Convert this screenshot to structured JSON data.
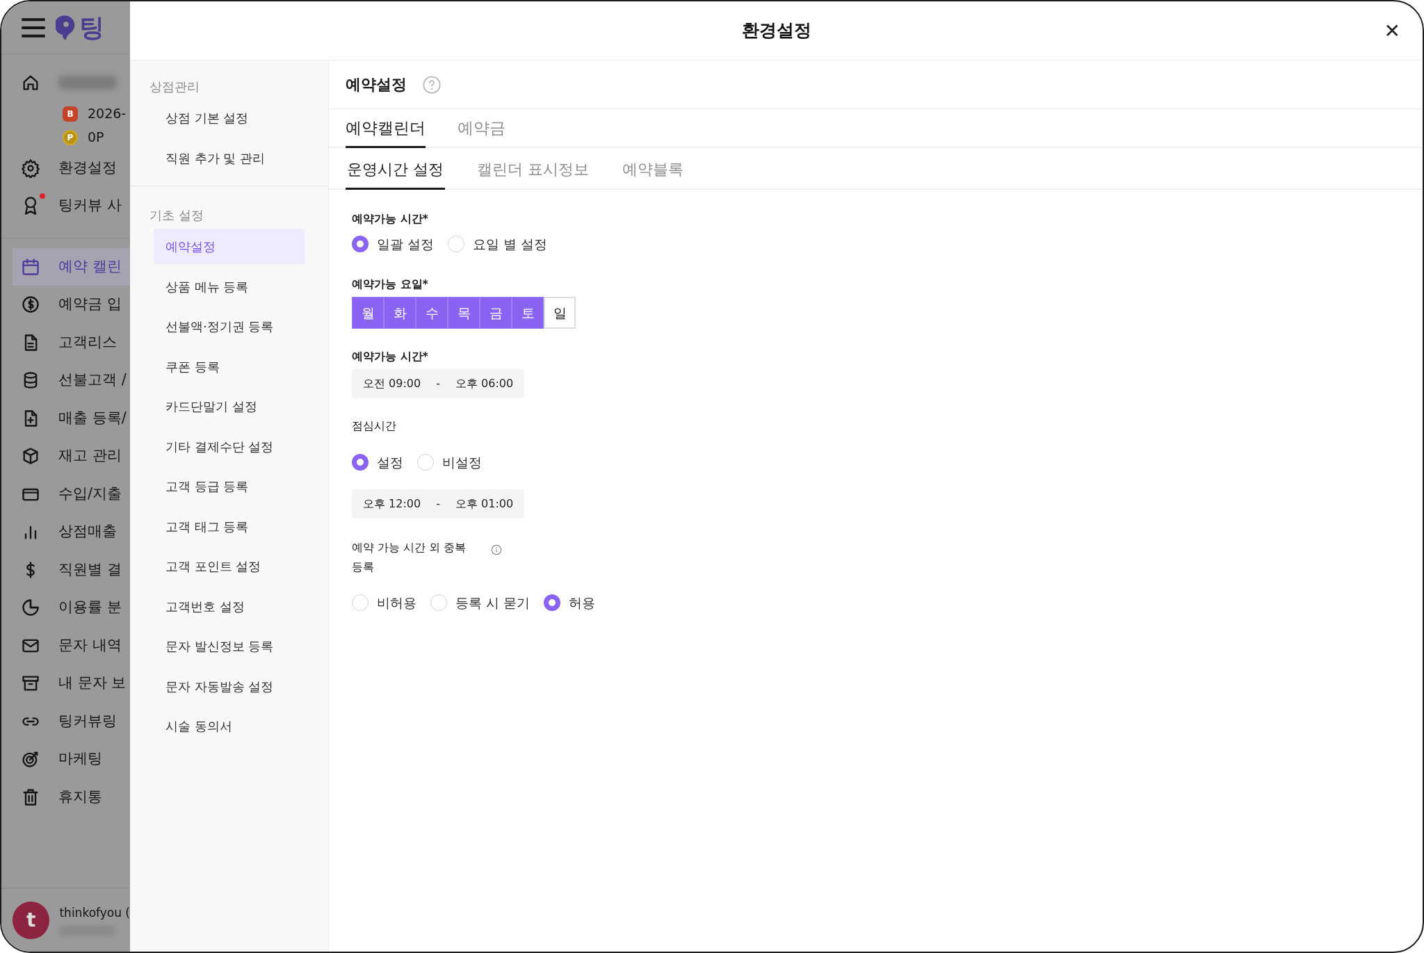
{
  "app_sidebar": {
    "logo_text": "팅",
    "profile": {
      "badge": "B",
      "expiry": "2026-",
      "points_badge": "P",
      "points": "0P"
    },
    "groups": [
      [
        {
          "label": "환경설정",
          "selected": false,
          "alert": false
        },
        {
          "label": "팅커뷰 사",
          "selected": false,
          "alert": true
        }
      ],
      [
        {
          "label": "예약 캘린",
          "selected": true,
          "alert": false
        },
        {
          "label": "예약금 입",
          "selected": false,
          "alert": false
        },
        {
          "label": "고객리스",
          "selected": false,
          "alert": false
        },
        {
          "label": "선불고객 /",
          "selected": false,
          "alert": false
        },
        {
          "label": "매출 등록/",
          "selected": false,
          "alert": false
        },
        {
          "label": "재고 관리",
          "selected": false,
          "alert": false
        },
        {
          "label": "수입/지출",
          "selected": false,
          "alert": false
        },
        {
          "label": "상점매출",
          "selected": false,
          "alert": false
        },
        {
          "label": "직원별 결",
          "selected": false,
          "alert": false
        },
        {
          "label": "이용률 분",
          "selected": false,
          "alert": false
        },
        {
          "label": "문자 내역",
          "selected": false,
          "alert": false
        },
        {
          "label": "내 문자 보",
          "selected": false,
          "alert": false
        },
        {
          "label": "팅커뷰링",
          "selected": false,
          "alert": false
        },
        {
          "label": "마케팅",
          "selected": false,
          "alert": false
        },
        {
          "label": "휴지통",
          "selected": false,
          "alert": false
        }
      ]
    ],
    "user": {
      "initial": "t",
      "name": "thinkofyou ("
    }
  },
  "modal": {
    "title": "환경설정",
    "close": "✕"
  },
  "settings_nav": [
    {
      "heading": "상점관리",
      "items": [
        {
          "label": "상점 기본 설정",
          "selected": false
        },
        {
          "label": "직원 추가 및 관리",
          "selected": false
        }
      ]
    },
    {
      "heading": "기초 설정",
      "items": [
        {
          "label": "예약설정",
          "selected": true
        },
        {
          "label": "상품 메뉴 등록",
          "selected": false
        },
        {
          "label": "선불액·정기권 등록",
          "selected": false
        },
        {
          "label": "쿠폰 등록",
          "selected": false
        },
        {
          "label": "카드단말기 설정",
          "selected": false
        },
        {
          "label": "기타 결제수단 설정",
          "selected": false
        },
        {
          "label": "고객 등급 등록",
          "selected": false
        },
        {
          "label": "고객 태그 등록",
          "selected": false
        },
        {
          "label": "고객 포인트 설정",
          "selected": false
        },
        {
          "label": "고객번호 설정",
          "selected": false
        },
        {
          "label": "문자 발신정보 등록",
          "selected": false
        },
        {
          "label": "문자 자동발송 설정",
          "selected": false
        },
        {
          "label": "시술 동의서",
          "selected": false
        }
      ]
    }
  ],
  "page": {
    "title": "예약설정",
    "tabs": [
      {
        "label": "예약캘린더",
        "selected": true
      },
      {
        "label": "예약금",
        "selected": false
      }
    ],
    "subtabs": [
      {
        "label": "운영시간 설정",
        "selected": true
      },
      {
        "label": "캘린더 표시정보",
        "selected": false
      },
      {
        "label": "예약블록",
        "selected": false
      }
    ],
    "sections": [
      {
        "kind": "radio",
        "label": "예약가능 시간*",
        "strong": true,
        "info": false,
        "options": [
          {
            "label": "일괄 설정",
            "selected": true
          },
          {
            "label": "요일 별 설정",
            "selected": false
          }
        ]
      },
      {
        "kind": "days",
        "label": "예약가능 요일*",
        "strong": true,
        "days": [
          {
            "label": "월",
            "selected": true
          },
          {
            "label": "화",
            "selected": true
          },
          {
            "label": "수",
            "selected": true
          },
          {
            "label": "목",
            "selected": true
          },
          {
            "label": "금",
            "selected": true
          },
          {
            "label": "토",
            "selected": true
          },
          {
            "label": "일",
            "selected": false
          }
        ]
      },
      {
        "kind": "time_range",
        "label": "예약가능 시간*",
        "strong": true,
        "start": "오전 09:00",
        "separator": "-",
        "end": "오후 06:00"
      },
      {
        "kind": "radio",
        "label": "점심시간",
        "strong": false,
        "info": false,
        "options": [
          {
            "label": "설정",
            "selected": true
          },
          {
            "label": "비설정",
            "selected": false
          }
        ]
      },
      {
        "kind": "time_range",
        "start": "오후 12:00",
        "separator": "-",
        "end": "오후 01:00"
      },
      {
        "kind": "radio",
        "label": "예약 가능 시간 외 중복 등록",
        "strong": false,
        "info": true,
        "options": [
          {
            "label": "비허용",
            "selected": false
          },
          {
            "label": "등록 시 묻기",
            "selected": false
          },
          {
            "label": "허용",
            "selected": true
          }
        ]
      }
    ]
  }
}
